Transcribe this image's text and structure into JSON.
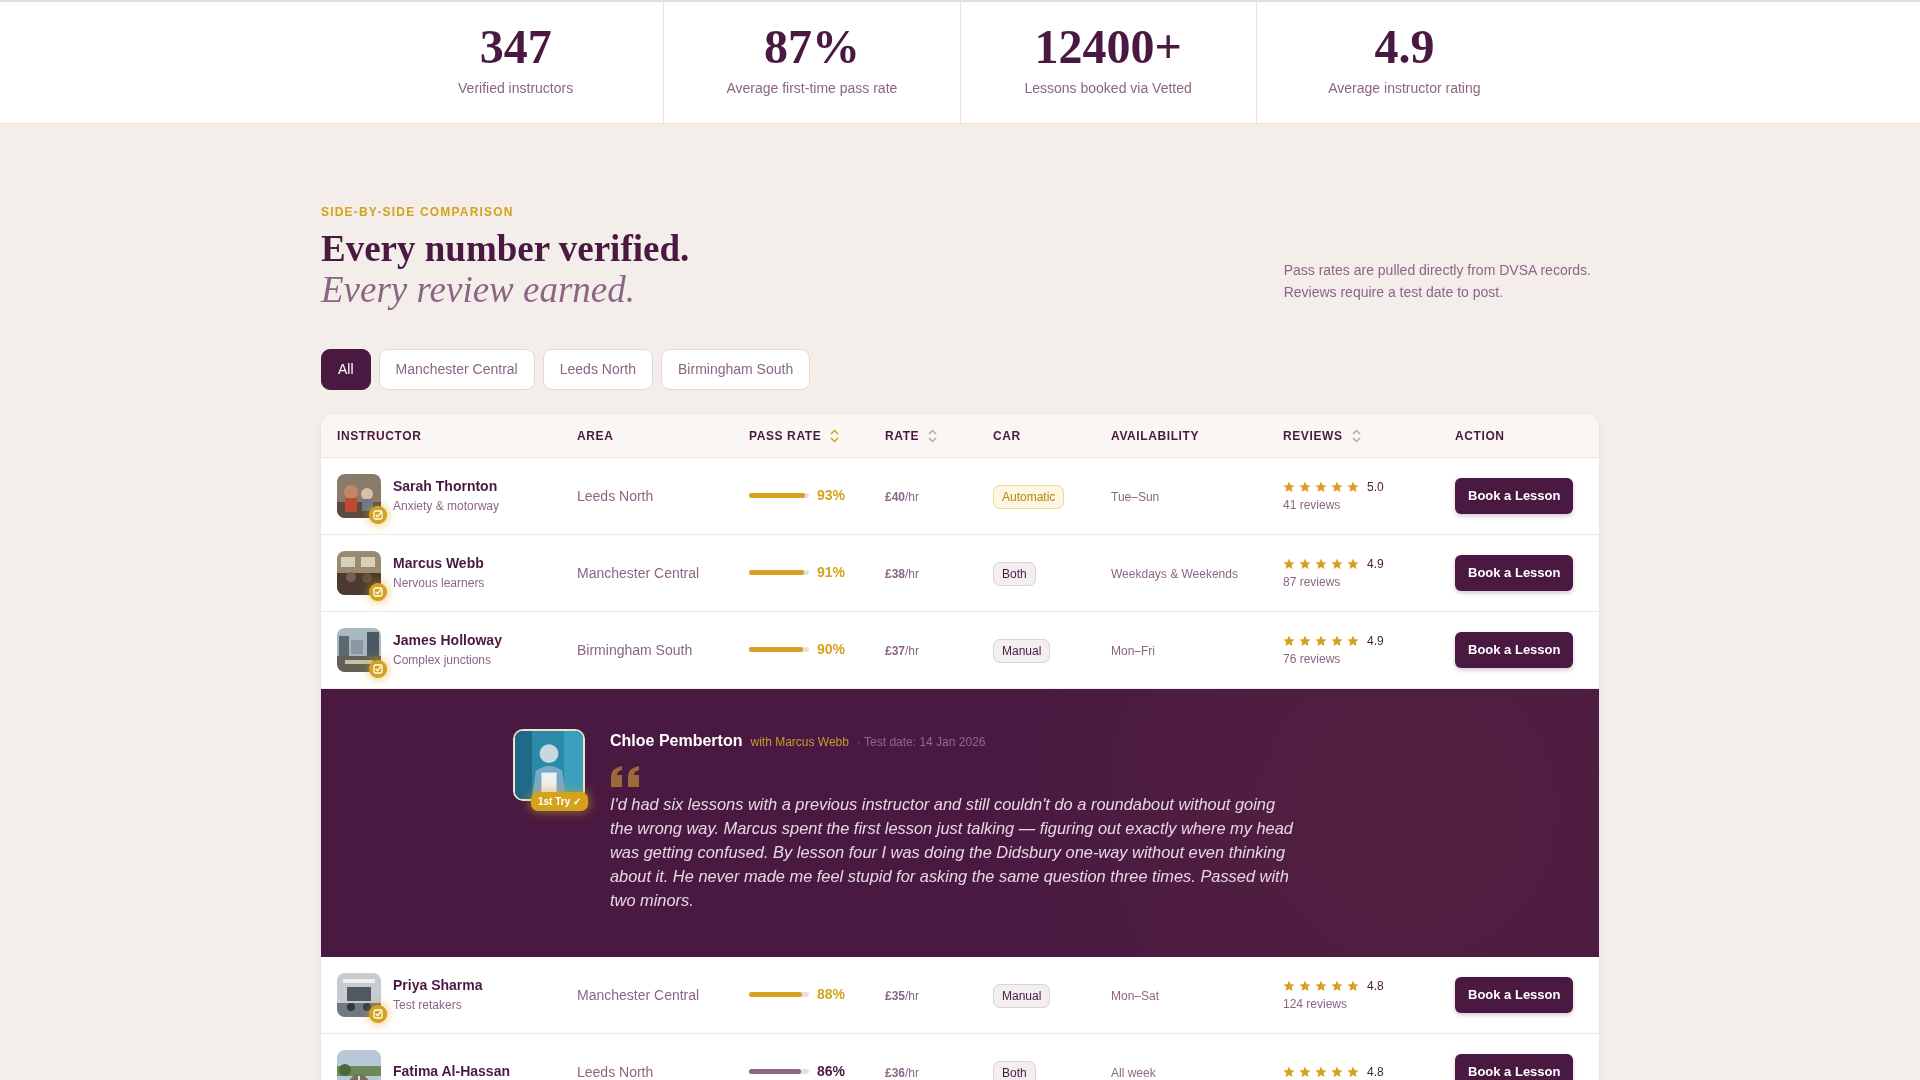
{
  "stats": [
    {
      "value": "347",
      "label": "Verified instructors"
    },
    {
      "value": "87%",
      "label": "Average first-time pass rate"
    },
    {
      "value": "12400+",
      "label": "Lessons booked via Vetted"
    },
    {
      "value": "4.9",
      "label": "Average instructor rating"
    }
  ],
  "section": {
    "eyebrow": "SIDE-BY-SIDE COMPARISON",
    "title": "Every number verified.",
    "subtitle": "Every review earned.",
    "note": [
      "Pass rates are pulled directly from DVSA records.",
      "Reviews require a test date to post."
    ]
  },
  "filters": [
    {
      "label": "All",
      "selected": true
    },
    {
      "label": "Manchester Central",
      "selected": false
    },
    {
      "label": "Leeds North",
      "selected": false
    },
    {
      "label": "Birmingham South",
      "selected": false
    }
  ],
  "table": {
    "columns": [
      {
        "label": "INSTRUCTOR"
      },
      {
        "label": "AREA"
      },
      {
        "label": "PASS RATE",
        "sortable": true,
        "sorted": true
      },
      {
        "label": "RATE",
        "sortable": true,
        "sorted": false
      },
      {
        "label": "CAR"
      },
      {
        "label": "AVAILABILITY"
      },
      {
        "label": "REVIEWS",
        "sortable": true,
        "sorted": false
      },
      {
        "label": "ACTION"
      }
    ],
    "rows": [
      {
        "kind": "instructor",
        "name": "Sarah Thornton",
        "specialty": "Anxiety & motorway",
        "verified": true,
        "area": "Leeds North",
        "pass_rate": "93%",
        "level": 0.93,
        "color": "#d4a21c",
        "rate": "**£40**/hr",
        "car": {
          "label": "Automatic",
          "kind": "automatic"
        },
        "availability": "Tue–Sun",
        "stars": 5,
        "rating": "5.0",
        "reviews": "41 reviews",
        "action": "Book a Lesson"
      },
      {
        "kind": "instructor",
        "name": "Marcus Webb",
        "specialty": "Nervous learners",
        "verified": true,
        "area": "Manchester Central",
        "pass_rate": "91%",
        "level": 0.91,
        "color": "#d4a21c",
        "rate": "**£38**/hr",
        "car": {
          "label": "Both",
          "kind": "plain"
        },
        "availability": "Weekdays & Weekends",
        "stars": 5,
        "rating": "4.9",
        "reviews": "87 reviews",
        "action": "Book a Lesson"
      },
      {
        "kind": "instructor",
        "name": "James Holloway",
        "specialty": "Complex junctions",
        "verified": true,
        "area": "Birmingham South",
        "pass_rate": "90%",
        "level": 0.9,
        "color": "#d4a21c",
        "rate": "**£37**/hr",
        "car": {
          "label": "Manual",
          "kind": "plain"
        },
        "availability": "Mon–Fri",
        "stars": 5,
        "rating": "4.9",
        "reviews": "76 reviews",
        "action": "Book a Lesson"
      },
      {
        "kind": "review",
        "reviewer": "Chloe Pemberton",
        "with": "with Marcus Webb",
        "test_date": "· Test date: 14 Jan 2026",
        "badge": "1st Try ✓",
        "quote": "I'd had six lessons with a previous instructor and still couldn't do a roundabout without going the wrong way. Marcus spent the first lesson just talking — figuring out exactly where my head was getting confused. By lesson four I was doing the Didsbury one-way without even thinking about it. He never made me feel stupid for asking the same question three times. Passed with two minors."
      },
      {
        "kind": "instructor",
        "name": "Priya Sharma",
        "specialty": "Test retakers",
        "verified": true,
        "area": "Manchester Central",
        "pass_rate": "88%",
        "level": 0.88,
        "color": "#d4a21c",
        "rate": "**£35**/hr",
        "car": {
          "label": "Manual",
          "kind": "plain"
        },
        "availability": "Mon–Sat",
        "stars": 5,
        "rating": "4.8",
        "reviews": "124 reviews",
        "action": "Book a Lesson"
      },
      {
        "kind": "instructor",
        "name": "Fatima Al-Hassan",
        "area": "Leeds North",
        "pass_rate": "86%",
        "level": 0.86,
        "color": "#8c6585",
        "rate": "**£36**/hr",
        "car": {
          "label": "Both",
          "kind": "plain"
        },
        "availability": "All week",
        "stars": 5,
        "rating": "4.8",
        "action": "Book a Lesson"
      }
    ]
  }
}
